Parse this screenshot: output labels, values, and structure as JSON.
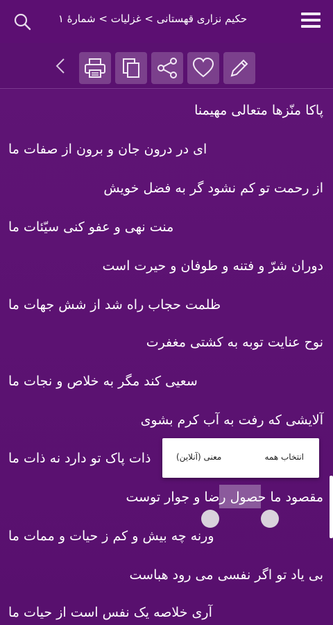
{
  "header": {
    "breadcrumb": "حکیم نزاری قهستانی > غزلیات > شمارهٔ ۱"
  },
  "toolbar": {
    "icons": [
      "chevron-left-icon",
      "print-icon",
      "copy-icon",
      "share-icon",
      "heart-icon",
      "edit-icon"
    ]
  },
  "verses": [
    "پاکا منّزها متعالی مهیمنا",
    "ای در درون جان و برون از صفات ما",
    "از رحمت تو کم نشود گر به فضل خویش",
    "منت نهی و عفو کنی سیّئات ما",
    "دوران شرّ و فتنه و طوفان و حیرت است",
    "ظلمت حجاب راه شد از شش جهات ما",
    "نوح عنایت توبه به کشتی مغفرت",
    "سعیی کند مگر به خلاص و نجات ما",
    "آلایشی که رفت به آب کرم بشوی",
    "ذات پاک تو دارد نه ذات ما",
    "مقصود ما حصول رضا و جوار توست",
    "ورنه چه بیش و کم ز حیات و ممات ما",
    "بی یاد تو اگر نفسی می رود هباست",
    "آری خلاصه یک نفس است از حیات ما"
  ],
  "context_menu": {
    "select_all": "انتخاب همه",
    "meaning_online": "معنی (آنلاین)"
  },
  "colors": {
    "background": "#5a1170",
    "topbar": "#5c0f72",
    "text": "#ffffff"
  }
}
